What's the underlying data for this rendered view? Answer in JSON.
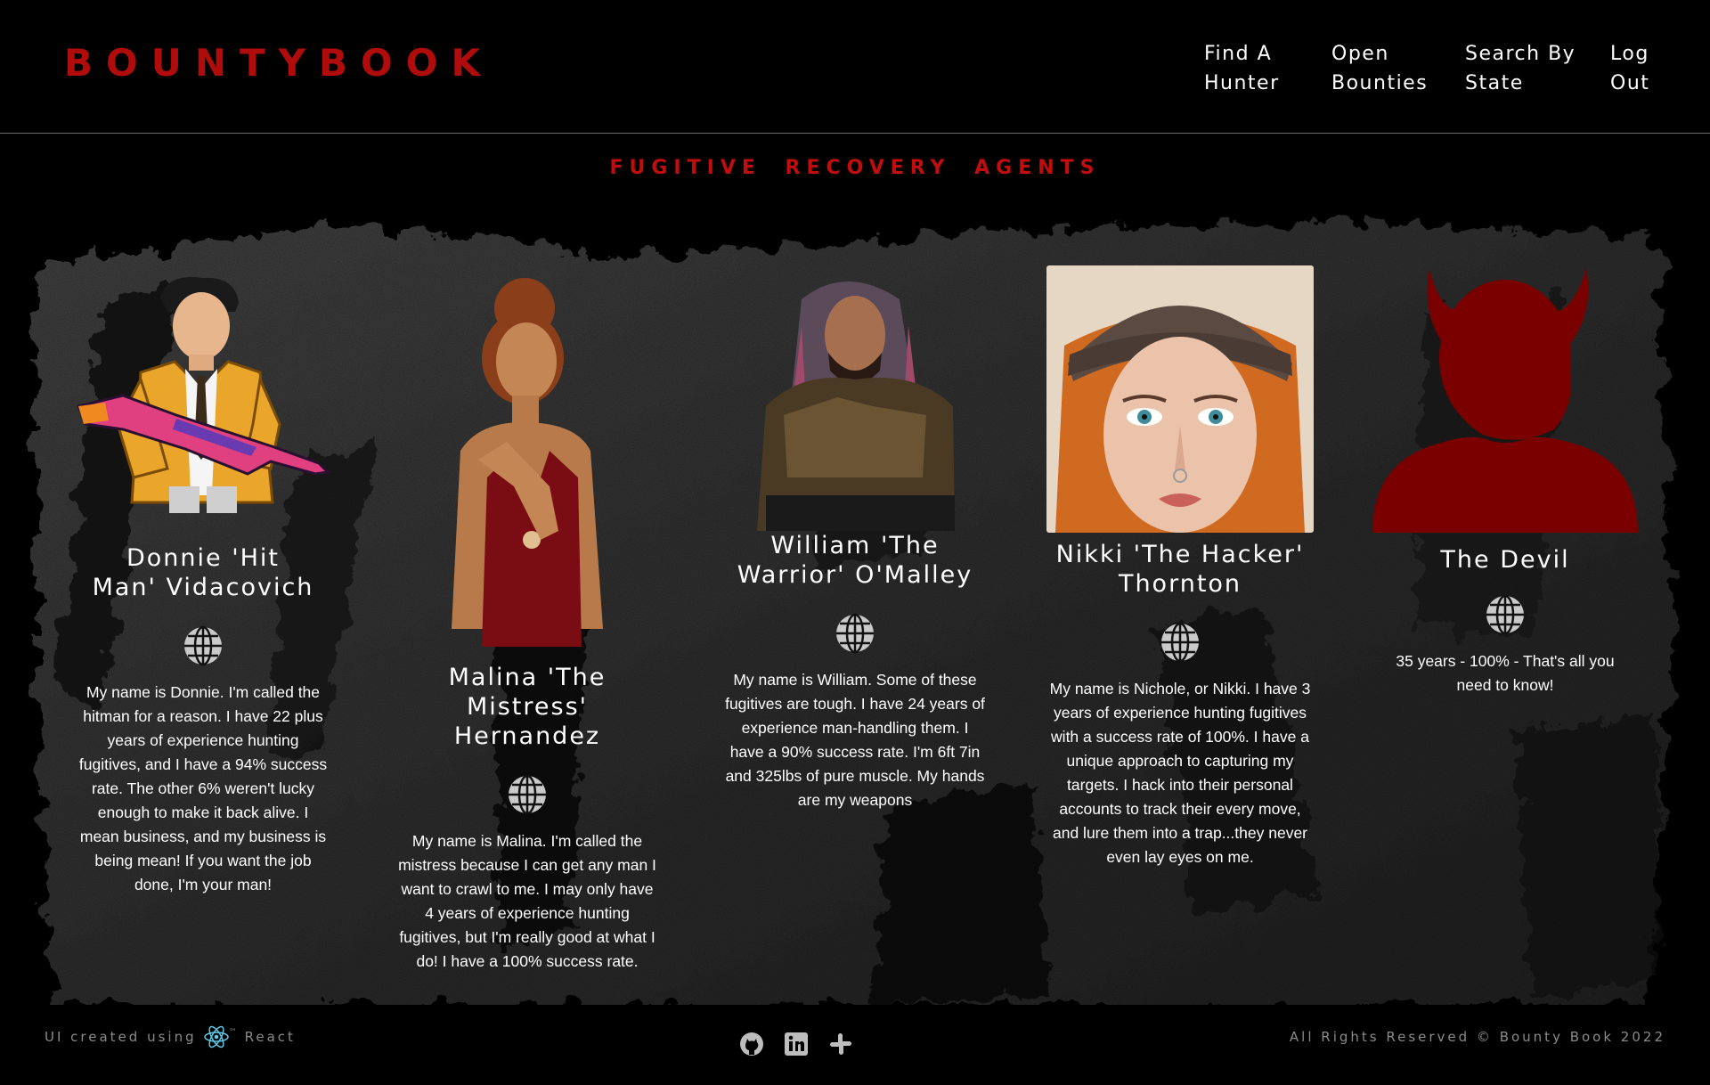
{
  "header": {
    "logo": "BOUNTYBOOK",
    "nav": [
      {
        "label": "Find A\nHunter"
      },
      {
        "label": "Open\nBounties"
      },
      {
        "label": "Search By\nState"
      },
      {
        "label": "Log\nOut"
      }
    ]
  },
  "main": {
    "title": "FUGITIVE RECOVERY AGENTS",
    "agents": [
      {
        "name": "Donnie 'Hit Man' Vidacovich",
        "bio": "My name is Donnie. I'm called the hitman for a reason. I have 22 plus years of experience hunting fugitives, and I have a 94% success rate. The other 6% weren't lucky enough to make it back alive. I mean business, and my business is being mean! If you want the job done, I'm your man!"
      },
      {
        "name": "Malina 'The Mistress' Hernandez",
        "bio": "My name is Malina. I'm called the mistress because I can get any man I want to crawl to me. I may only have 4 years of experience hunting fugitives, but I'm really good at what I do! I have a 100% success rate."
      },
      {
        "name": "William 'The Warrior' O'Malley",
        "bio": "My name is William. Some of these fugitives are tough. I have 24 years of experience man-handling them. I have a 90% success rate. I'm 6ft 7in and 325lbs of pure muscle. My hands are my weapons"
      },
      {
        "name": "Nikki 'The Hacker' Thornton",
        "bio": "My name is Nichole, or Nikki. I have 3 years of experience hunting fugitives with a success rate of 100%. I have a unique approach to capturing my targets. I hack into their personal accounts to track their every move, and lure them into a trap...they never even lay eyes on me."
      },
      {
        "name": "The Devil",
        "bio": "35 years - 100% - That's all you need to know!"
      }
    ]
  },
  "footer": {
    "created_prefix": "UI created using",
    "created_tech": "React",
    "tm": "™",
    "copyright": "All Rights Reserved © Bounty Book 2022",
    "icons": [
      "github-icon",
      "linkedin-icon",
      "slack-icon"
    ]
  },
  "colors": {
    "brand_red": "#b10c0c",
    "devil_red": "#7a0000",
    "background": "#000000",
    "footer_text": "#8a8a8a"
  }
}
